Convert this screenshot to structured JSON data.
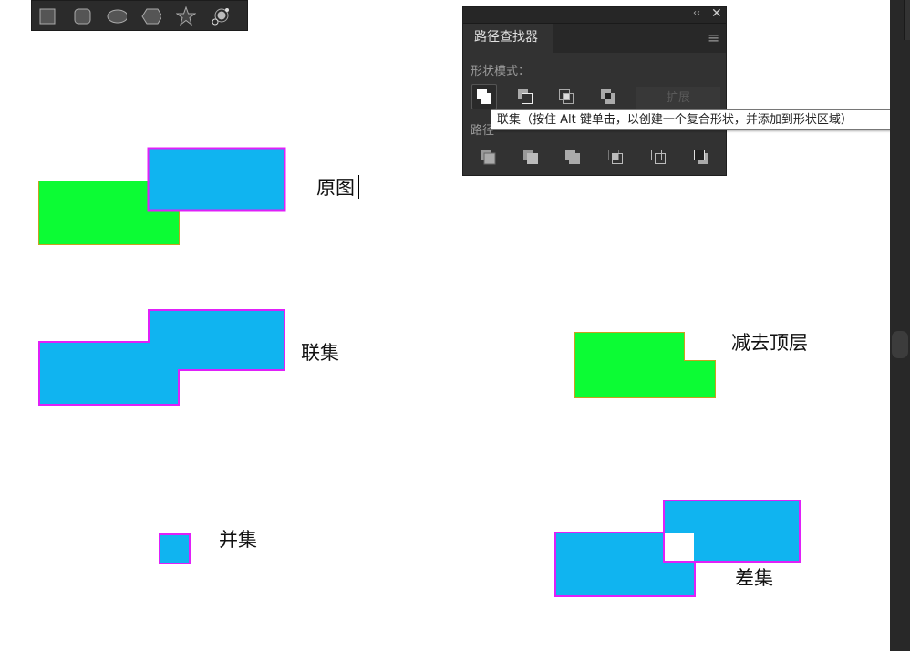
{
  "toolbar": {
    "tools": [
      "rectangle-tool",
      "rounded-rectangle-tool",
      "ellipse-tool",
      "polygon-tool",
      "star-tool",
      "flare-tool"
    ]
  },
  "canvas": {
    "labels": {
      "original": "原图",
      "unite": "联集",
      "minus_front": "减去顶层",
      "intersect": "并集",
      "exclude": "差集"
    },
    "colors": {
      "blue": "#10b4f0",
      "green": "#0cfc34",
      "stroke": "#e020f8",
      "green_stroke": "#c8a020"
    }
  },
  "panel": {
    "title": "路径查找器",
    "shape_modes_label": "形状模式：",
    "pathfinders_label": "路径",
    "expand_label": "扩展",
    "shape_modes": [
      "unite",
      "minus-front",
      "intersect",
      "exclude"
    ],
    "pathfinders": [
      "divide",
      "trim",
      "merge",
      "crop",
      "outline",
      "minus-back"
    ]
  },
  "tooltip": {
    "text": "联集（按住 Alt 键单击，以创建一个复合形状，并添加到形状区域）"
  }
}
